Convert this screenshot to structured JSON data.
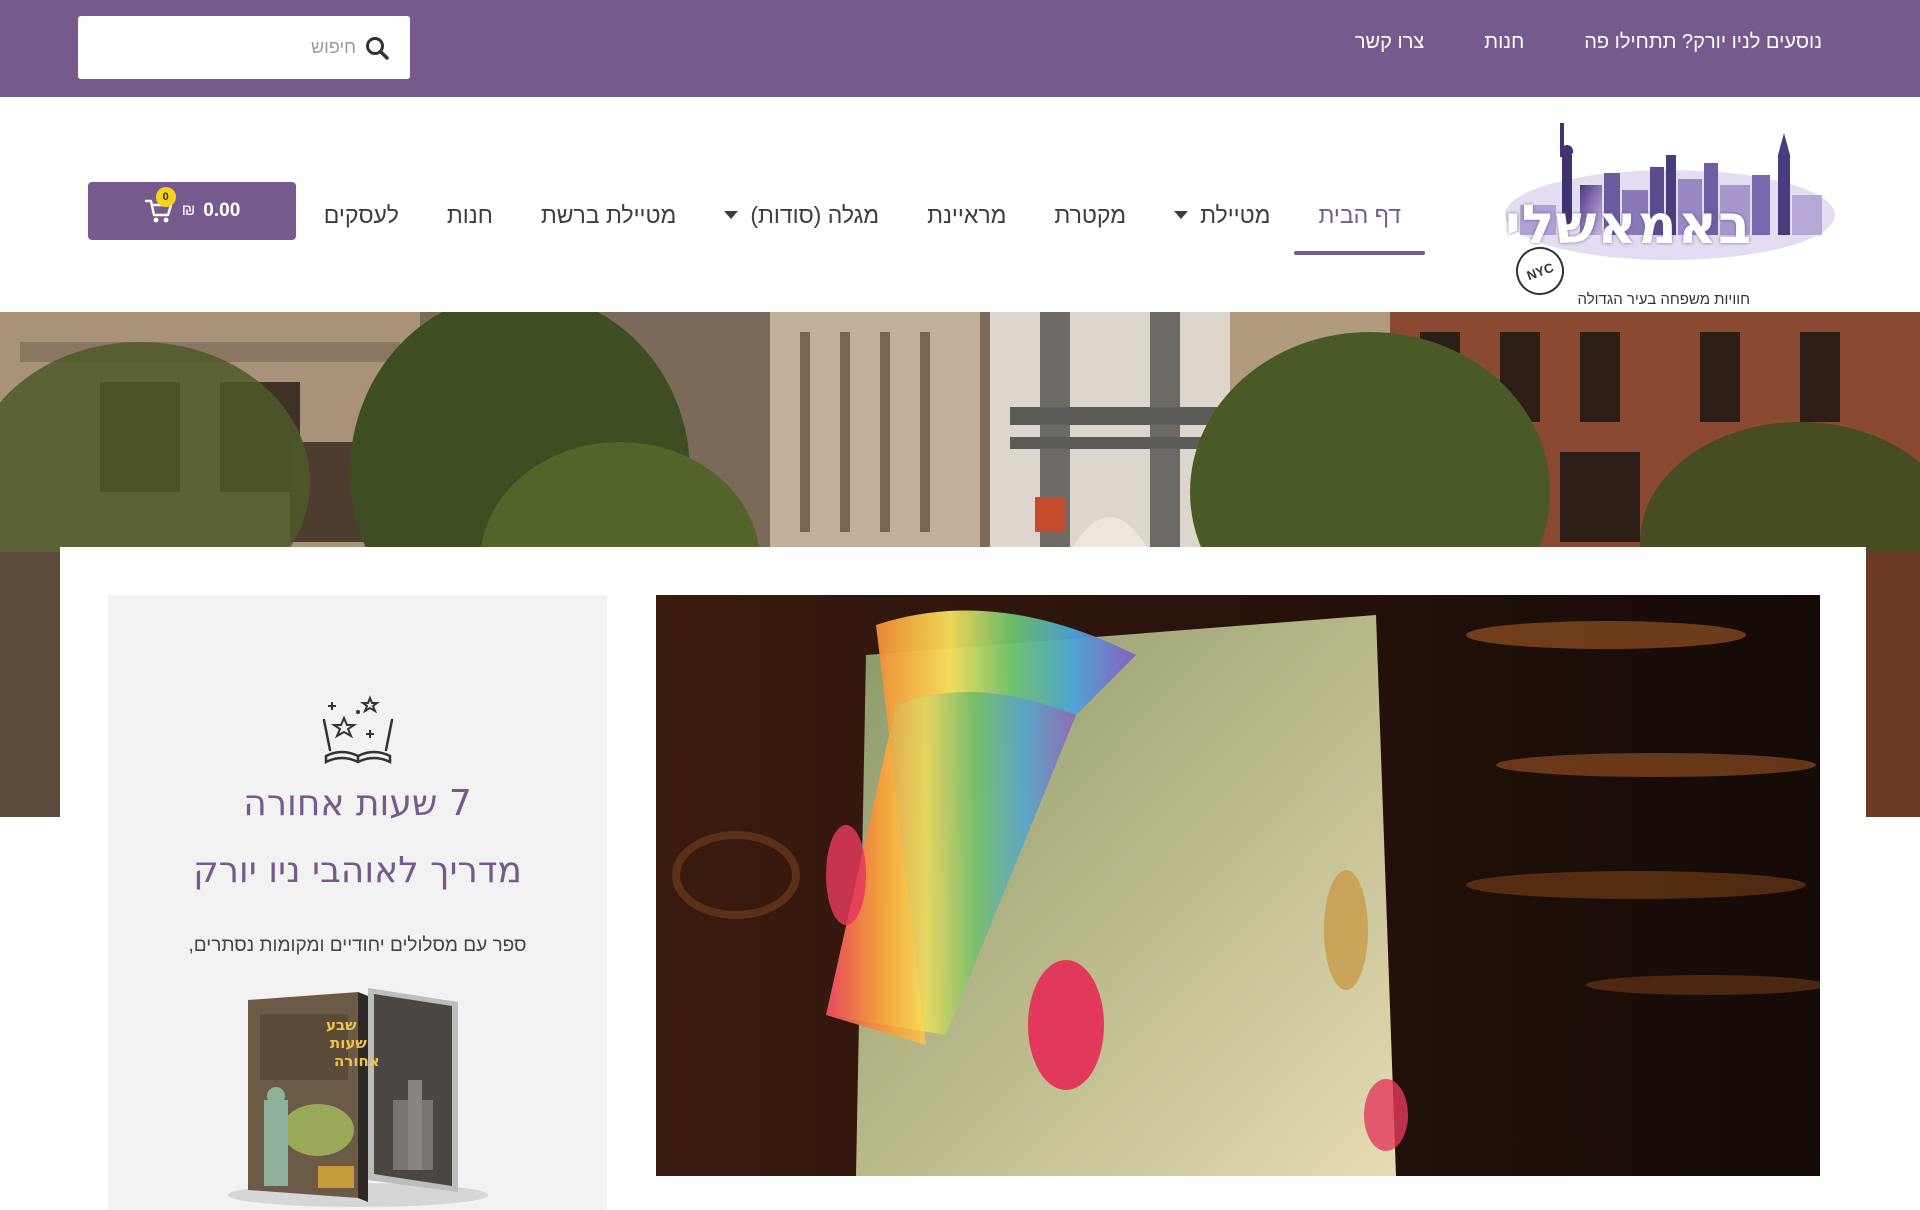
{
  "topbar": {
    "links": [
      "נוסעים לניו יורק? תתחילו פה",
      "חנות",
      "צרו קשר"
    ],
    "search": {
      "placeholder": "חיפוש",
      "icon": "search-icon"
    }
  },
  "brand": {
    "logo_text": "באמאשלי",
    "tagline": "חוויות משפחה בעיר הגדולה",
    "badge": "NYC"
  },
  "nav": {
    "items": [
      {
        "label": "דף הבית",
        "active": true,
        "dropdown": false
      },
      {
        "label": "מטיילת",
        "active": false,
        "dropdown": true
      },
      {
        "label": "מקטרת",
        "active": false,
        "dropdown": false
      },
      {
        "label": "מראיינת",
        "active": false,
        "dropdown": false
      },
      {
        "label": "מגלה (סודות)",
        "active": false,
        "dropdown": true
      },
      {
        "label": "מטיילת ברשת",
        "active": false,
        "dropdown": false
      },
      {
        "label": "חנות",
        "active": false,
        "dropdown": false
      },
      {
        "label": "לעסקים",
        "active": false,
        "dropdown": false
      }
    ]
  },
  "cart": {
    "amount": "0.00",
    "currency": "₪",
    "count": "0"
  },
  "promo": {
    "title_line1": "7 שעות אחורה",
    "title_line2": "מדריך לאוהבי ניו יורק",
    "description": "ספר עם מסלולים יחודיים ומקומות נסתרים,",
    "book_cover_text": "שבע שעות אחורה"
  },
  "colors": {
    "brand_purple": "#755b8d",
    "cart_badge": "#f4d21d",
    "promo_bg": "#f2f2f2"
  }
}
